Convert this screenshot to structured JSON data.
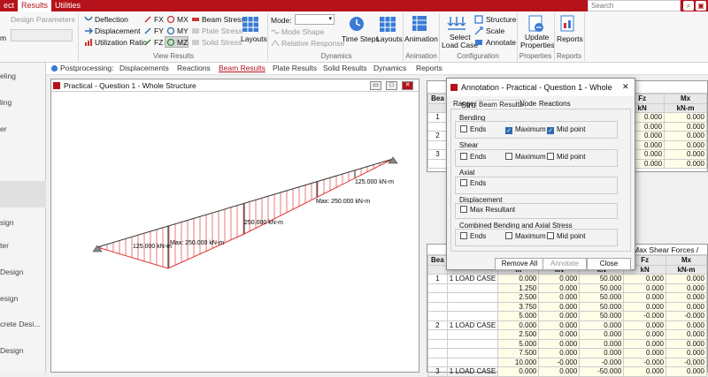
{
  "topbar": {
    "tabs": [
      "ect",
      "Results",
      "Utilities"
    ],
    "search_placeholder": "Search"
  },
  "ribbon": {
    "design_parameters": "Design Parameters",
    "m_label": "m",
    "view_results": {
      "deflection": "Deflection",
      "displacement": "Displacement",
      "utilization_ratio": "Utilization Ratio",
      "fx": "FX",
      "mx": "MX",
      "beam_stress": "Beam Stress",
      "fy": "FY",
      "my": "MY",
      "plate_stress": "Plate Stress",
      "fz": "FZ",
      "mz": "MZ",
      "solid_stress": "Solid Stress",
      "layouts": "Layouts",
      "group": "View Results"
    },
    "dynamics": {
      "mode": "Mode:",
      "mode_shape": "Mode Shape",
      "relative_response": "Relative Response",
      "time_steps": "Time Steps",
      "layouts": "Layouts",
      "group": "Dynamics"
    },
    "animation": {
      "label": "Animation",
      "group": "Animation"
    },
    "configuration": {
      "select_load_case_1": "Select",
      "select_load_case_2": "Load Case",
      "structure": "Structure",
      "scale": "Scale",
      "annotate": "Annotate",
      "group": "Configuration"
    },
    "properties": {
      "update_1": "Update",
      "update_2": "Properties",
      "group": "Properties"
    },
    "reports": {
      "label": "Reports",
      "group": "Reports"
    }
  },
  "postprocessing": {
    "label": "Postprocessing:",
    "tabs": [
      "Displacements",
      "Reactions",
      "Beam Results",
      "Plate Results",
      "Solid Results",
      "Dynamics",
      "Reports"
    ]
  },
  "sidebar": {
    "items": [
      "eling",
      "ling",
      "er",
      "",
      "sign",
      "ter",
      "Design",
      "esign",
      "crete Desi...",
      "Design"
    ]
  },
  "drawing": {
    "title": "Practical - Question 1 - Whole Structure",
    "labels": {
      "l1": "125.000 kN-m",
      "l2": "Max: 250.000 kN-m",
      "l3": "250.000 kN-m",
      "l4": "Max: 250.000 kN-m",
      "l5": "125.000 kN-m"
    }
  },
  "table_top": {
    "headers": [
      "Bea",
      "Fz",
      "Mx"
    ],
    "units": [
      "",
      "kN",
      "kN-m"
    ],
    "beams": [
      "1",
      "2",
      "3"
    ],
    "rows": [
      [
        "0.000",
        "0.000"
      ],
      [
        "0.000",
        "0.000"
      ],
      [
        "0.000",
        "0.000"
      ],
      [
        "0.000",
        "0.000"
      ],
      [
        "0.000",
        "0.000"
      ],
      [
        "0.000",
        "0.000"
      ]
    ]
  },
  "table_bottom": {
    "title_suffix": "Max Shear Forces /",
    "headers": [
      "Bea",
      "Fz",
      "Mx"
    ],
    "units": [
      "m",
      "kN",
      "kN",
      "kN",
      "kN-m"
    ],
    "rows": [
      [
        "1",
        "1 LOAD CASE",
        "0.000",
        "0.000",
        "50.000",
        "0.000",
        "0.000"
      ],
      [
        "",
        "",
        "1.250",
        "0.000",
        "50.000",
        "0.000",
        "0.000"
      ],
      [
        "",
        "",
        "2.500",
        "0.000",
        "50.000",
        "0.000",
        "0.000"
      ],
      [
        "",
        "",
        "3.750",
        "0.000",
        "50.000",
        "0.000",
        "0.000"
      ],
      [
        "",
        "",
        "5.000",
        "0.000",
        "50.000",
        "-0.000",
        "-0.000"
      ],
      [
        "2",
        "1 LOAD CASE",
        "0.000",
        "0.000",
        "0.000",
        "0.000",
        "0.000"
      ],
      [
        "",
        "",
        "2.500",
        "0.000",
        "0.000",
        "0.000",
        "0.000"
      ],
      [
        "",
        "",
        "5.000",
        "0.000",
        "0.000",
        "0.000",
        "0.000"
      ],
      [
        "",
        "",
        "7.500",
        "0.000",
        "0.000",
        "0.000",
        "0.000"
      ],
      [
        "",
        "",
        "10.000",
        "-0.000",
        "-0.000",
        "-0.000",
        "-0.000"
      ],
      [
        "3",
        "1 LOAD CASE",
        "0.000",
        "0.000",
        "-50.000",
        "0.000",
        "0.000"
      ]
    ]
  },
  "dialog": {
    "title": "Annotation - Practical - Question 1 - Whole Structure",
    "tabs": [
      "Ranges",
      "Beam Results",
      "Node",
      "Reactions"
    ],
    "bending": {
      "label": "Bending",
      "ends": "Ends",
      "maximum": "Maximum",
      "mid": "Mid point"
    },
    "shear": {
      "label": "Shear",
      "ends": "Ends",
      "maximum": "Maximum",
      "mid": "Mid point"
    },
    "axial": {
      "label": "Axial",
      "ends": "Ends"
    },
    "displacement": {
      "label": "Displacement",
      "max_resultant": "Max Resultant"
    },
    "combined": {
      "label": "Combined Bending and Axial Stress",
      "ends": "Ends",
      "maximum": "Maximum",
      "mid": "Mid point"
    },
    "buttons": {
      "remove_all": "Remove All",
      "annotate": "Annotate",
      "close": "Close"
    },
    "close_x": "✕"
  }
}
